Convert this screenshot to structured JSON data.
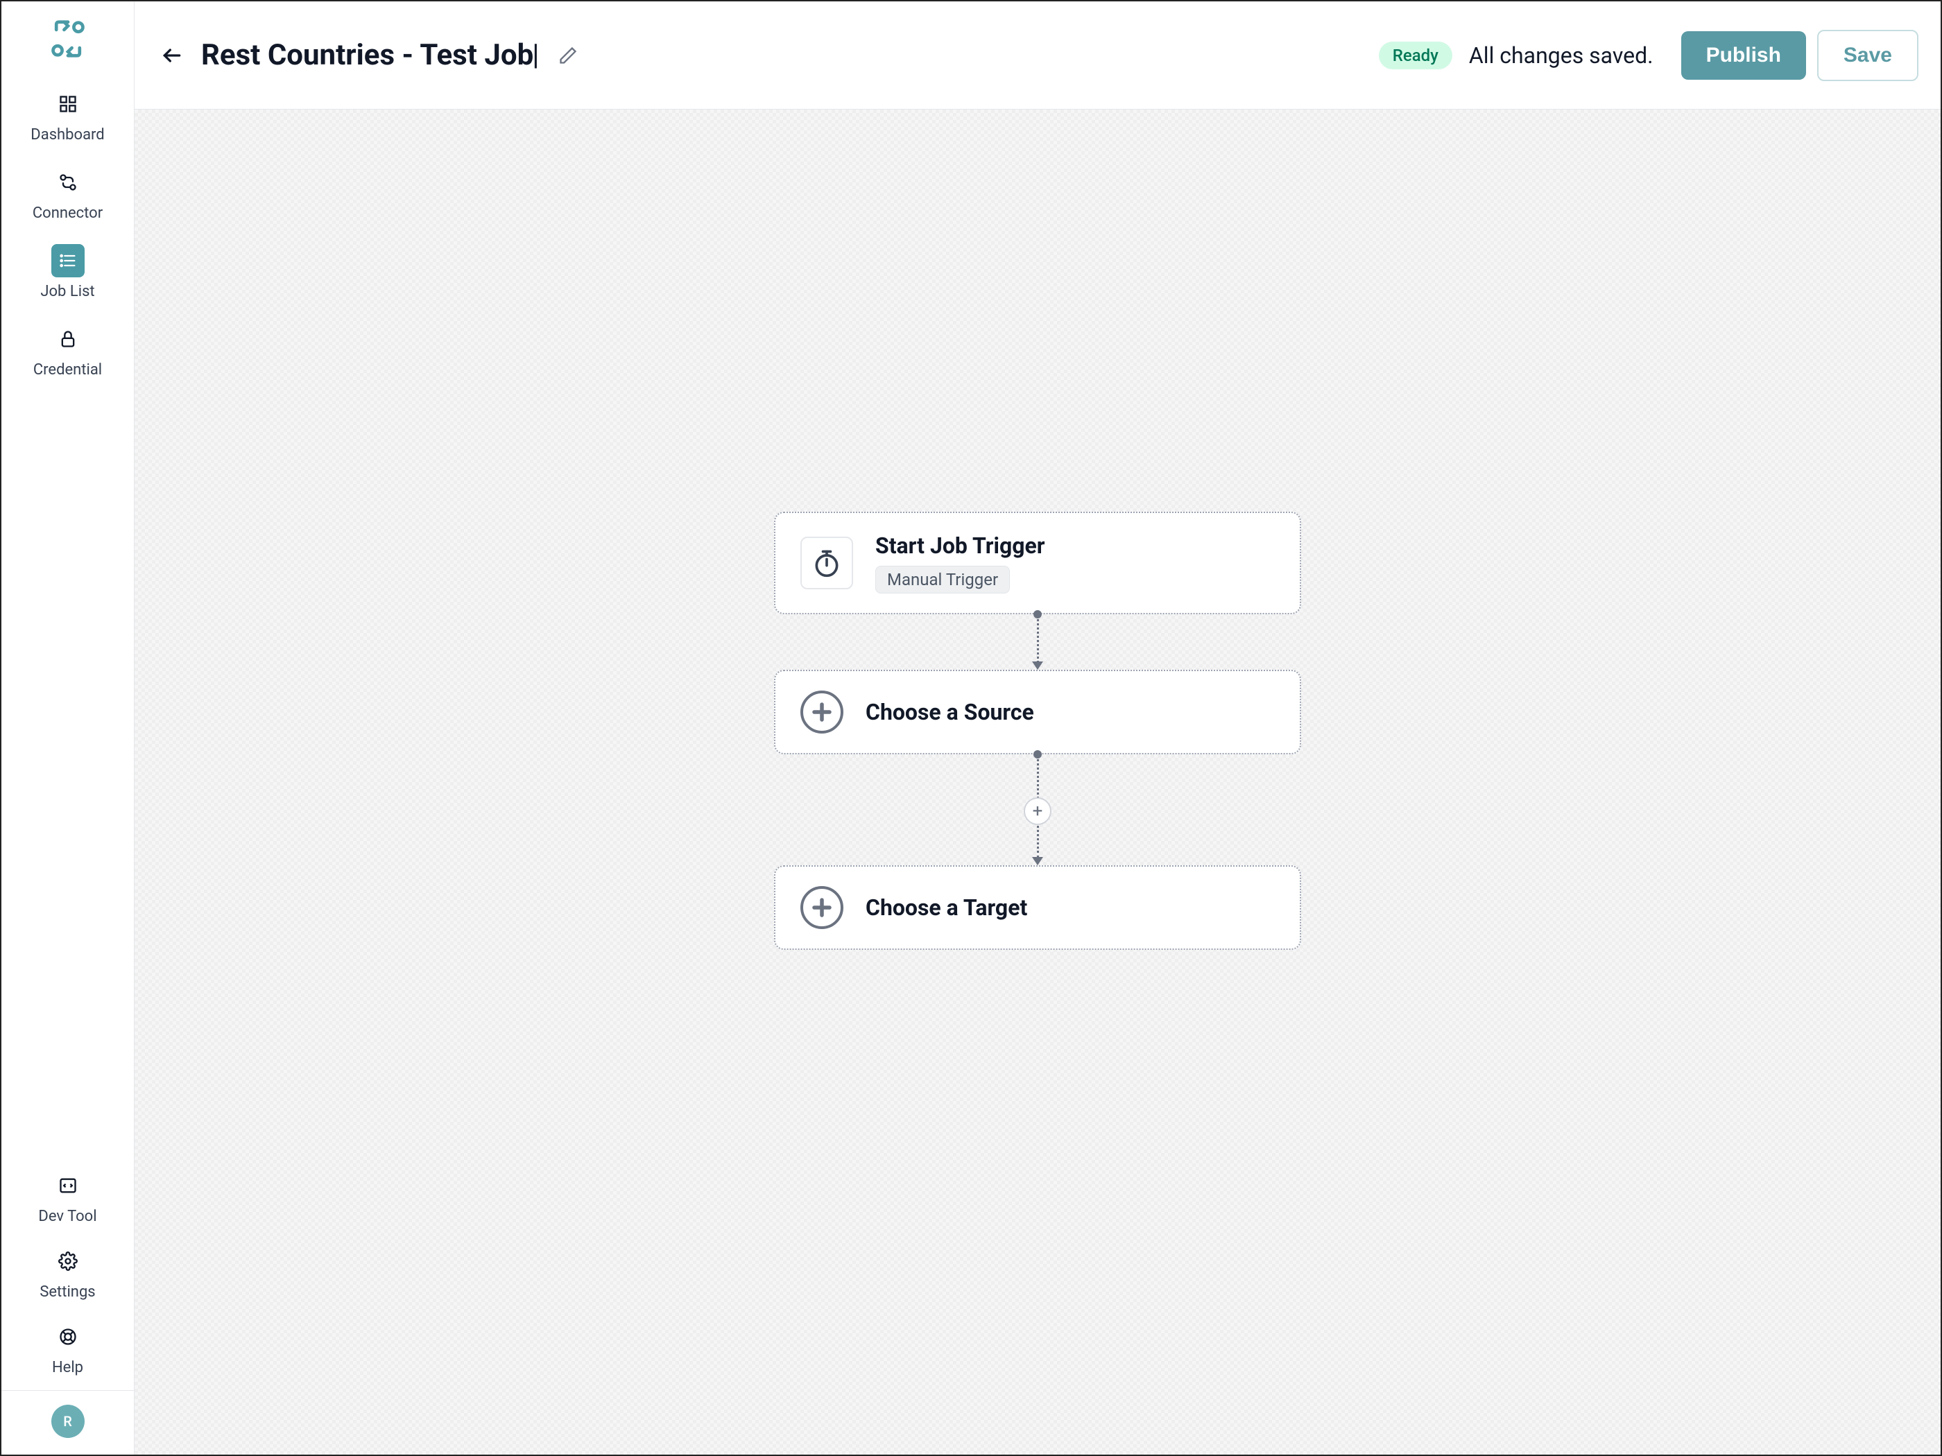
{
  "sidebar": {
    "items": [
      {
        "label": "Dashboard"
      },
      {
        "label": "Connector"
      },
      {
        "label": "Job List"
      },
      {
        "label": "Credential"
      }
    ],
    "bottom": [
      {
        "label": "Dev Tool"
      },
      {
        "label": "Settings"
      },
      {
        "label": "Help"
      }
    ],
    "avatar_initial": "R"
  },
  "header": {
    "title": "Rest Countries - Test Job",
    "status_badge": "Ready",
    "save_status": "All changes saved.",
    "publish_label": "Publish",
    "save_label": "Save"
  },
  "flow": {
    "nodes": [
      {
        "title": "Start Job Trigger",
        "tag": "Manual Trigger"
      },
      {
        "title": "Choose a Source"
      },
      {
        "title": "Choose a Target"
      }
    ],
    "add_step_label": "+"
  },
  "colors": {
    "accent": "#5a9aa4",
    "badge_bg": "#d1fae5",
    "badge_fg": "#047857"
  }
}
